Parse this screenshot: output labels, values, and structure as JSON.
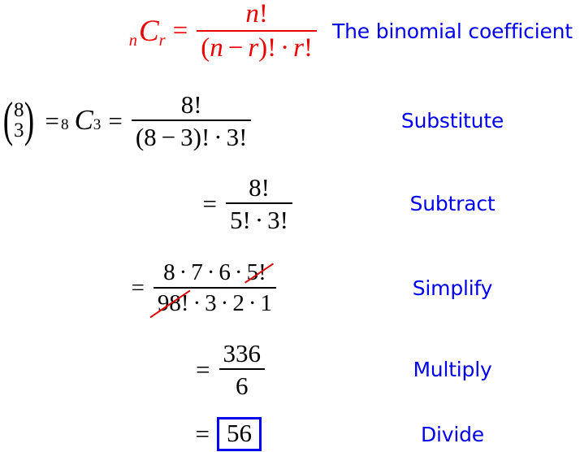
{
  "document": {
    "title": "Binomial coefficient worked example",
    "background_color": "#ffffff",
    "formula_color": "#ee0000",
    "label_color": "#0000ee",
    "math_color": "#000000",
    "cancel_color": "#dd0000"
  },
  "rows": [
    {
      "id": "formula",
      "label": "The binomial coefficient",
      "expression": "nCr = n! / ((n - r)! * r!)",
      "color": "#ee0000",
      "parts": {
        "lhs_n": "n",
        "lhs_C": "C",
        "lhs_r": "r",
        "equals": "=",
        "numerator": "n!",
        "numerator_var": "n",
        "numerator_bang": "!",
        "den_open": "(",
        "den_n": "n",
        "den_minus": "−",
        "den_r": "r",
        "den_close": ")",
        "den_bang1": "!",
        "den_dot": "·",
        "den_r2": "r",
        "den_bang2": "!"
      }
    },
    {
      "id": "substitute",
      "label": "Substitute",
      "expression": "(8 choose 3) = 8C3 = 8! / ((8 - 3)! * 3!)",
      "color": "#000000",
      "parts": {
        "binom_top": "8",
        "binom_bottom": "3",
        "equals1": "=",
        "sub_n": "8",
        "big_C": "C",
        "sub_r": "3",
        "equals2": "=",
        "numerator": "8!",
        "den_open": "(",
        "den_8": "8",
        "den_minus": "−",
        "den_3": "3",
        "den_close": ")",
        "den_bang1": "!",
        "den_dot": "·",
        "den_3b": "3",
        "den_bang2": "!"
      }
    },
    {
      "id": "subtract",
      "label": "Subtract",
      "expression": "= 8! / (5! * 3!)",
      "color": "#000000",
      "parts": {
        "equals": "=",
        "numerator": "8!",
        "den_5": "5",
        "den_bang1": "!",
        "den_dot": "·",
        "den_3": "3",
        "den_bang2": "!"
      }
    },
    {
      "id": "simplify",
      "label": "Simplify",
      "expression": "= (8 * 7 * 6 * 5!) / (98! * 3 * 2 * 1) with 5! cancelled",
      "color": "#000000",
      "parts": {
        "equals": "=",
        "num_8": "8",
        "num_dot1": "·",
        "num_7": "7",
        "num_dot2": "·",
        "num_6": "6",
        "num_dot3": "·",
        "num_cancel": "5!",
        "den_cancel": "98!",
        "den_dot1": "·",
        "den_3": "3",
        "den_dot2": "·",
        "den_2": "2",
        "den_dot3": "·",
        "den_1": "1"
      }
    },
    {
      "id": "multiply",
      "label": "Multiply",
      "expression": "= 336 / 6",
      "color": "#000000",
      "parts": {
        "equals": "=",
        "numerator": "336",
        "denominator": "6"
      }
    },
    {
      "id": "divide",
      "label": "Divide",
      "expression": "= 56",
      "color": "#000000",
      "parts": {
        "equals": "=",
        "answer": "56"
      }
    }
  ]
}
